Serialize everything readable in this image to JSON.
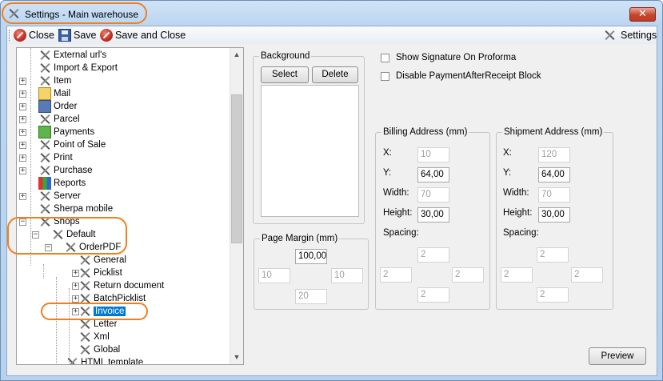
{
  "window": {
    "title": "Settings - Main warehouse",
    "close_glyph": "✕"
  },
  "toolbar": {
    "close_label": "Close",
    "save_label": "Save",
    "save_close_label": "Save and Close",
    "settings_label": "Settings"
  },
  "tree": {
    "items": [
      {
        "label": "External url's",
        "icon": "tools-icon"
      },
      {
        "label": "Import & Export",
        "icon": "import-export-icon"
      },
      {
        "label": "Item",
        "icon": "item-icon"
      },
      {
        "label": "Mail",
        "icon": "mail-icon"
      },
      {
        "label": "Order",
        "icon": "order-icon"
      },
      {
        "label": "Parcel",
        "icon": "tools-icon"
      },
      {
        "label": "Payments",
        "icon": "payments-icon"
      },
      {
        "label": "Point of Sale",
        "icon": "tools-icon"
      },
      {
        "label": "Print",
        "icon": "tools-icon"
      },
      {
        "label": "Purchase",
        "icon": "tools-icon"
      },
      {
        "label": "Reports",
        "icon": "reports-icon"
      },
      {
        "label": "Server",
        "icon": "tools-icon"
      },
      {
        "label": "Sherpa mobile",
        "icon": "tools-icon"
      },
      {
        "label": "Shops",
        "icon": "tools-icon"
      },
      {
        "label": "Default",
        "icon": "tools-icon"
      },
      {
        "label": "OrderPDF",
        "icon": "tools-icon"
      },
      {
        "label": "General",
        "icon": "tools-icon"
      },
      {
        "label": "Picklist",
        "icon": "tools-icon"
      },
      {
        "label": "Return document",
        "icon": "tools-icon"
      },
      {
        "label": "BatchPicklist",
        "icon": "tools-icon"
      },
      {
        "label": "Invoice",
        "icon": "tools-icon",
        "selected": true
      },
      {
        "label": "Letter",
        "icon": "tools-icon"
      },
      {
        "label": "Xml",
        "icon": "tools-icon"
      },
      {
        "label": "Global",
        "icon": "tools-icon"
      },
      {
        "label": "HTML template",
        "icon": "tools-icon"
      }
    ]
  },
  "background": {
    "label": "Background",
    "select_label": "Select",
    "delete_label": "Delete"
  },
  "options": {
    "show_signature": "Show Signature On Proforma",
    "disable_payment": "Disable PaymentAfterReceipt Block"
  },
  "page_margin": {
    "label": "Page Margin (mm)",
    "top": "100,00",
    "left": "10",
    "right": "10",
    "bottom": "20"
  },
  "billing": {
    "label": "Billing Address (mm)",
    "x_label": "X:",
    "y_label": "Y:",
    "width_label": "Width:",
    "height_label": "Height:",
    "spacing_label": "Spacing:",
    "x": "10",
    "y": "64,00",
    "width": "70",
    "height": "30,00",
    "sp_top": "2",
    "sp_left": "2",
    "sp_right": "2",
    "sp_bottom": "2"
  },
  "shipment": {
    "label": "Shipment Address (mm)",
    "x_label": "X:",
    "y_label": "Y:",
    "width_label": "Width:",
    "height_label": "Height:",
    "spacing_label": "Spacing:",
    "x": "120",
    "y": "64,00",
    "width": "70",
    "height": "30,00",
    "sp_top": "2",
    "sp_left": "2",
    "sp_right": "2",
    "sp_bottom": "2"
  },
  "preview_label": "Preview",
  "colors": {
    "annotation": "#f07f22",
    "selection": "#0078d7"
  }
}
